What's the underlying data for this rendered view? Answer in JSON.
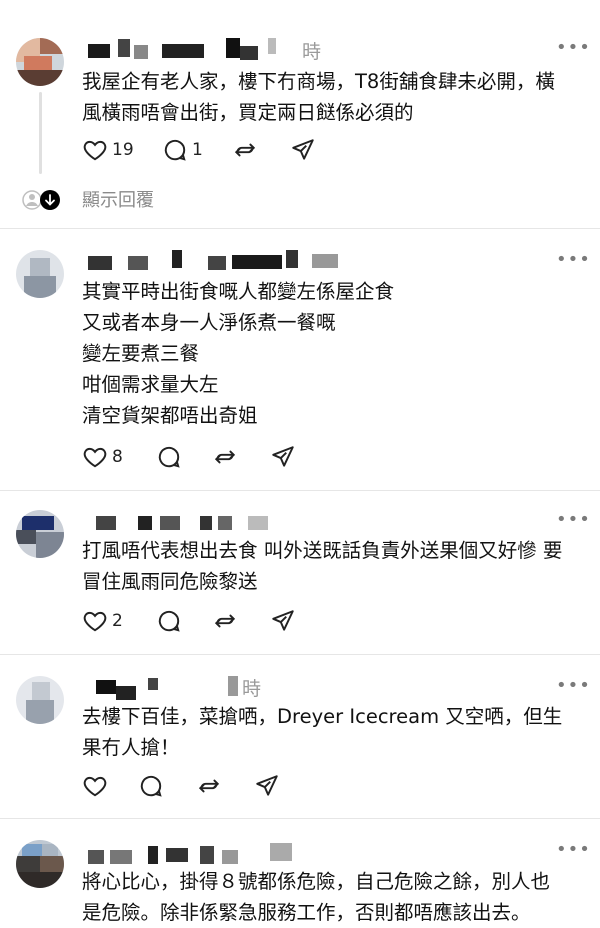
{
  "posts": [
    {
      "time": "時",
      "lines": [
        "我屋企有老人家，樓下冇商場，T8街舖食肆未必開，橫",
        "風橫雨唔會出街，買定兩日餸係必須的"
      ],
      "likes": "19",
      "replies": "1",
      "show_replies_label": "顯示回覆"
    },
    {
      "time": "",
      "lines": [
        "其實平時出街食嘅人都變左係屋企食",
        "又或者本身一人淨係煮一餐嘅",
        "變左要煮三餐",
        "咁個需求量大左",
        "清空貨架都唔出奇姐"
      ],
      "likes": "8",
      "replies": ""
    },
    {
      "time": "",
      "lines": [
        "打風唔代表想出去食 叫外送既話負責外送果個又好慘 要",
        "冒住風雨同危險黎送"
      ],
      "likes": "2",
      "replies": ""
    },
    {
      "time": "時",
      "lines": [
        "去樓下百佳，菜搶哂，Dreyer Icecream 又空哂，但生",
        "果冇人搶！"
      ],
      "likes": "",
      "replies": ""
    },
    {
      "time": "",
      "lines": [
        "將心比心，掛得８號都係危險，自己危險之餘，別人也",
        "是危險。除非係緊急服務工作，否則都唔應該出去。"
      ],
      "likes": "",
      "replies": ""
    }
  ],
  "icons": [
    "heart-icon",
    "comment-icon",
    "repost-icon",
    "share-icon",
    "more-icon"
  ],
  "colors": {
    "text": "#121212",
    "muted": "#9a9a9a",
    "divider": "#e6e6e6"
  }
}
